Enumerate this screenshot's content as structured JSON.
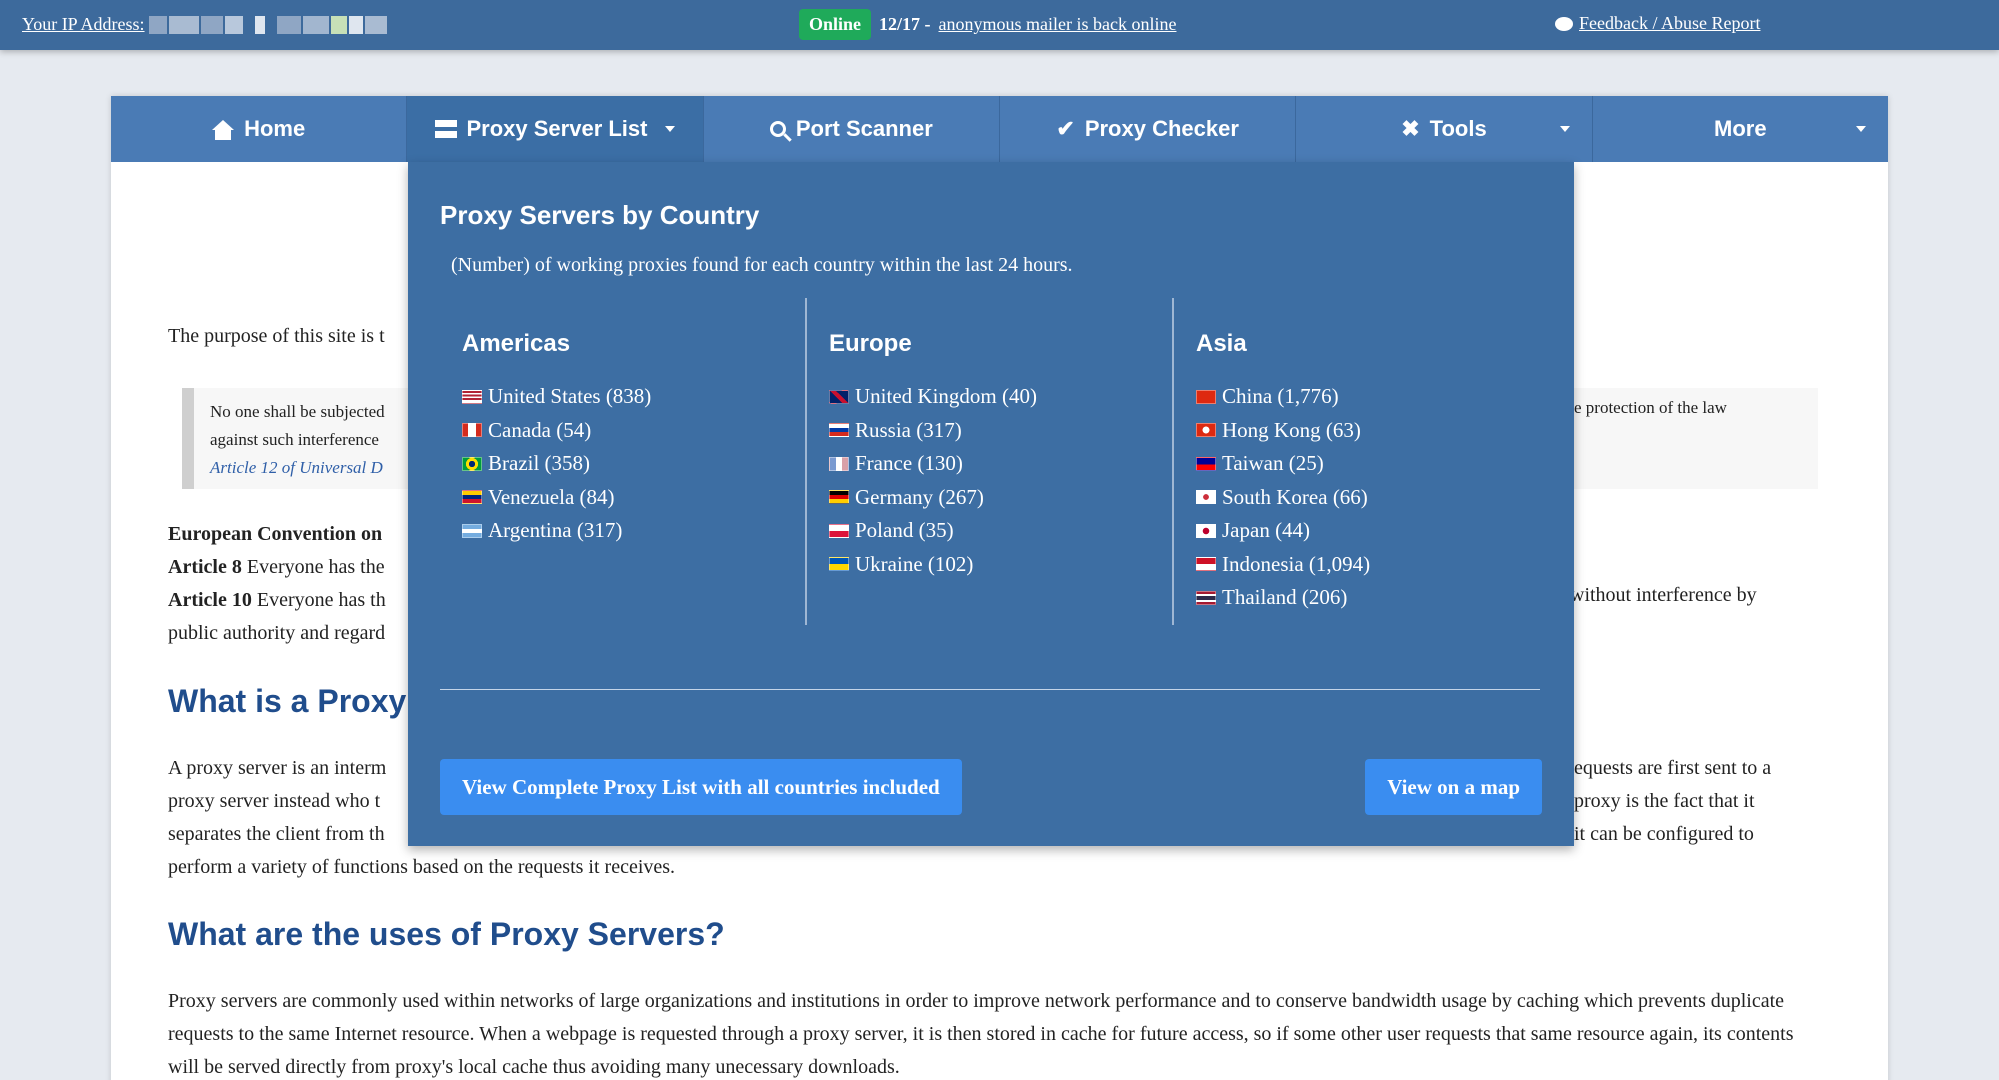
{
  "topbar": {
    "ip_label": "Your IP Address:",
    "online_badge": "Online",
    "date": "12/17 -",
    "news_link": "anonymous mailer is back online",
    "feedback_link": "Feedback / Abuse Report"
  },
  "nav": {
    "home": "Home",
    "proxy_list": "Proxy Server List",
    "port_scanner": "Port Scanner",
    "proxy_checker": "Proxy Checker",
    "tools": "Tools",
    "more": "More"
  },
  "dropdown": {
    "title": "Proxy Servers by Country",
    "subtitle": "(Number) of working proxies found for each country within the last 24 hours.",
    "americas": {
      "heading": "Americas",
      "items": [
        "United States (838)",
        "Canada (54)",
        "Brazil (358)",
        "Venezuela (84)",
        "Argentina (317)"
      ]
    },
    "europe": {
      "heading": "Europe",
      "items": [
        "United Kingdom (40)",
        "Russia (317)",
        "France (130)",
        "Germany (267)",
        "Poland (35)",
        "Ukraine (102)"
      ]
    },
    "asia": {
      "heading": "Asia",
      "items": [
        "China (1,776)",
        "Hong Kong (63)",
        "Taiwan (25)",
        "South Korea (66)",
        "Japan (44)",
        "Indonesia (1,094)",
        "Thailand (206)"
      ]
    },
    "complete_list_button": "View Complete Proxy List with all countries included",
    "map_button": "View on a map"
  },
  "content": {
    "purpose_fragment": "The purpose of this site is t",
    "quote_line1": "No one shall be subjected",
    "quote_line2": "against such interference",
    "quote_cite": "Article 12 of Universal D",
    "quote_right": "e protection of the law",
    "euro_heading": "European Convention on",
    "art8_label": "Article 8",
    "art8_text": " Everyone has the",
    "art10_label": "Article 10",
    "art10_text": " Everyone has th",
    "art10_right": "without interference by",
    "public_line": "public authority and regard",
    "h_what": "What is a Proxy",
    "proxy_p1_left": "A proxy server is an interm",
    "proxy_p1_right": "equests are first sent to a",
    "proxy_p2_left": "proxy server instead who t",
    "proxy_p2_right": "proxy is the fact that it",
    "proxy_p3_left": "separates the client from th",
    "proxy_p3_right": "it can be configured to",
    "proxy_p4": "perform a variety of functions based on the requests it receives.",
    "h_uses": "What are the uses of Proxy Servers?",
    "uses_p": "Proxy servers are commonly used within networks of large organizations and institutions in order to improve network performance and to conserve bandwidth usage by caching which prevents duplicate requests to the same Internet resource. When a webpage is requested through a proxy server, it is then stored in cache for future access, so if some other user requests that same resource again, its contents will be served directly from proxy's local cache thus avoiding many unecessary downloads."
  },
  "colors": {
    "topbar": "#3d6a9c",
    "nav": "#4a7bb5",
    "dropdown": "#3d6ea3",
    "button": "#3a8df0",
    "online": "#1faa5a",
    "heading": "#204d8c"
  }
}
